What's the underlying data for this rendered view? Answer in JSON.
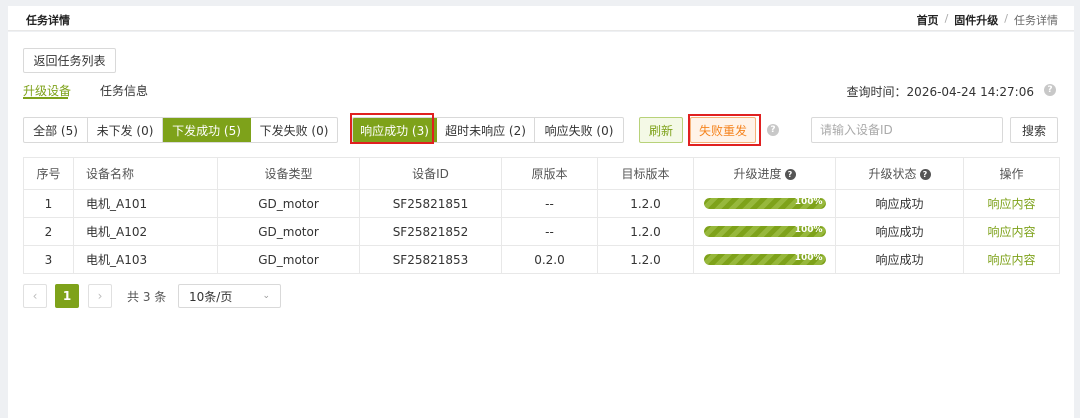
{
  "header": {
    "title": "任务详情",
    "breadcrumb": [
      "首页",
      "固件升级",
      "任务详情"
    ],
    "separator": "/"
  },
  "back_button": "返回任务列表",
  "tabs": [
    {
      "label": "升级设备",
      "active": true
    },
    {
      "label": "任务信息",
      "active": false
    }
  ],
  "query_time": "查询时间：2026-04-24 14:27:06",
  "help_icon": "question-circle-icon",
  "dispatch_filters": [
    {
      "label": "全部 (5)",
      "active": false
    },
    {
      "label": "未下发 (0)",
      "active": false
    },
    {
      "label": "下发成功 (5)",
      "active": true
    },
    {
      "label": "下发失败 (0)",
      "active": false
    }
  ],
  "response_filters": [
    {
      "label": "响应成功 (3)",
      "active": true
    },
    {
      "label": "超时未响应 (2)",
      "active": false
    },
    {
      "label": "响应失败 (0)",
      "active": false
    }
  ],
  "refresh_label": "刷新",
  "resend_label": "失败重发",
  "search": {
    "placeholder": "请输入设备ID",
    "value": "",
    "button": "搜索"
  },
  "table": {
    "columns": [
      "序号",
      "设备名称",
      "设备类型",
      "设备ID",
      "原版本",
      "目标版本",
      "升级进度",
      "升级状态",
      "操作"
    ],
    "rows": [
      {
        "index": "1",
        "name": "电机_A101",
        "type": "GD_motor",
        "id": "SF25821851",
        "old_version": "--",
        "target_version": "1.2.0",
        "progress": 100,
        "progress_label": "100%",
        "status": "响应成功",
        "action": "响应内容"
      },
      {
        "index": "2",
        "name": "电机_A102",
        "type": "GD_motor",
        "id": "SF25821852",
        "old_version": "--",
        "target_version": "1.2.0",
        "progress": 100,
        "progress_label": "100%",
        "status": "响应成功",
        "action": "响应内容"
      },
      {
        "index": "3",
        "name": "电机_A103",
        "type": "GD_motor",
        "id": "SF25821853",
        "old_version": "0.2.0",
        "target_version": "1.2.0",
        "progress": 100,
        "progress_label": "100%",
        "status": "响应成功",
        "action": "响应内容"
      }
    ]
  },
  "pagination": {
    "prev": "‹",
    "current": "1",
    "next": "›",
    "total": "共 3 条",
    "page_size": "10条/页"
  },
  "colors": {
    "accent": "#7ea21a",
    "highlight": "#e02020",
    "warning": "#f5841f"
  }
}
